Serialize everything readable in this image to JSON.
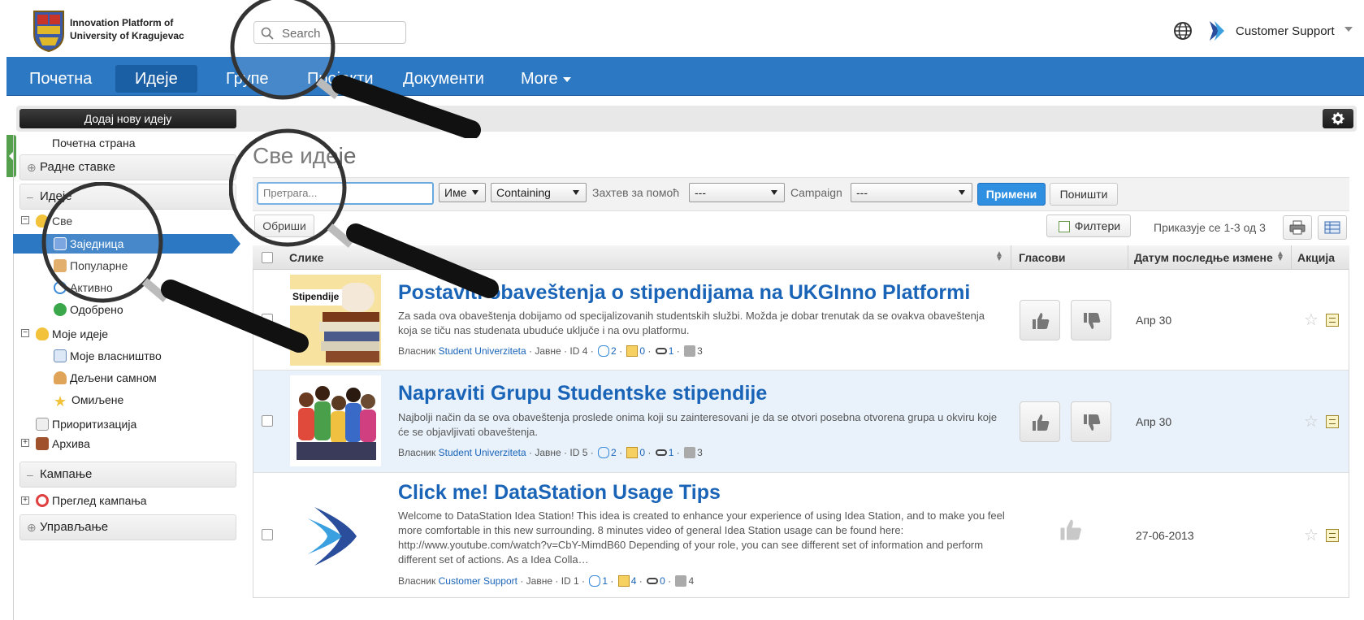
{
  "header": {
    "org_line1": "Innovation Platform of",
    "org_line2": "University of Kragujevac",
    "search_placeholder": "Search",
    "user_name": "Customer Support"
  },
  "nav": {
    "items": [
      {
        "label": "Почетна"
      },
      {
        "label": "Идеје"
      },
      {
        "label": "Групе"
      },
      {
        "label": "Пројекти"
      },
      {
        "label": "Документи"
      },
      {
        "label": "More"
      }
    ]
  },
  "sidebar": {
    "add_button": "Додај нову идеју",
    "home_link": "Почетна страна",
    "section_work": "Радне ставке",
    "section_ideas": "Идеје",
    "all": "Све",
    "community": "Заједница",
    "popular": "Популарне",
    "active": "Активно",
    "approved": "Одобрено",
    "my_ideas": "Моје идеје",
    "my_ownership": "Моје власништво",
    "shared_with_me": "Дељени самном",
    "favorites": "Омиљене",
    "prioritization": "Приоритизација",
    "archive": "Архива",
    "section_campaigns": "Кампање",
    "campaign_overview": "Преглед кампања",
    "section_management": "Управљање"
  },
  "main": {
    "page_title": "Све идеје",
    "filter": {
      "search_value": "Претрага...",
      "field_select": "Име",
      "op_select": "Containing",
      "help_label": "Захтев за помоћ",
      "help_select": "---",
      "campaign_label": "Campaign",
      "campaign_select": "---",
      "apply": "Примени",
      "cancel": "Поништи",
      "delete": "Обриши",
      "filters": "Филтери",
      "results": "Приказује се 1-3 од 3"
    },
    "columns": {
      "images": "Слике",
      "votes": "Гласови",
      "last_modified": "Датум последње измене",
      "action": "Акција"
    },
    "rows": [
      {
        "title": "Postaviti obaveštenja o stipendijama na UKGInno Platformi",
        "desc": "Za sada ova obaveštenja dobijamo od specijalizovanih studentskih službi. Možda je dobar trenutak da se ovakva obaveštenja koja se tiču nas studenata ubuduće uključe i na ovu platformu.",
        "owner_label": "Власник",
        "owner": "Student Univerziteta",
        "visibility": "· Јавне · ID 4 ·",
        "comments": "2",
        "attachments": "0",
        "links": "1",
        "votes_count": "3",
        "date": "Апр 30",
        "thumb_label": "Stipendije"
      },
      {
        "title": "Napraviti Grupu Studentske stipendije",
        "desc": "Najbolji način da se ova obaveštenja proslede onima koji su zainteresovani je da se otvori posebna otvorena grupa u okviru koje će se objavljivati obaveštenja.",
        "owner_label": "Власник",
        "owner": "Student Univerziteta",
        "visibility": "· Јавне · ID 5 ·",
        "comments": "2",
        "attachments": "0",
        "links": "1",
        "votes_count": "3",
        "date": "Апр 30"
      },
      {
        "title": "Click me! DataStation Usage Tips",
        "desc": "Welcome to DataStation Idea Station! This idea is created to enhance your experience of using Idea Station, and to make you feel more comfortable in this new surrounding. 8 minutes video of general Idea Station usage can be found here: http://www.youtube.com/watch?v=CbY-MimdB60 Depending of your role, you can see different set of information and perform different set of actions. As a Idea Colla…",
        "owner_label": "Власник",
        "owner": "Customer Support",
        "visibility": "· Јавне · ID 1 ·",
        "comments": "1",
        "attachments": "4",
        "links": "0",
        "votes_count": "4",
        "date": "27-06-2013"
      }
    ]
  },
  "colors": {
    "nav_blue": "#2d78c2",
    "link_blue": "#1a64b8",
    "highlight_row": "#e9f2fb"
  }
}
